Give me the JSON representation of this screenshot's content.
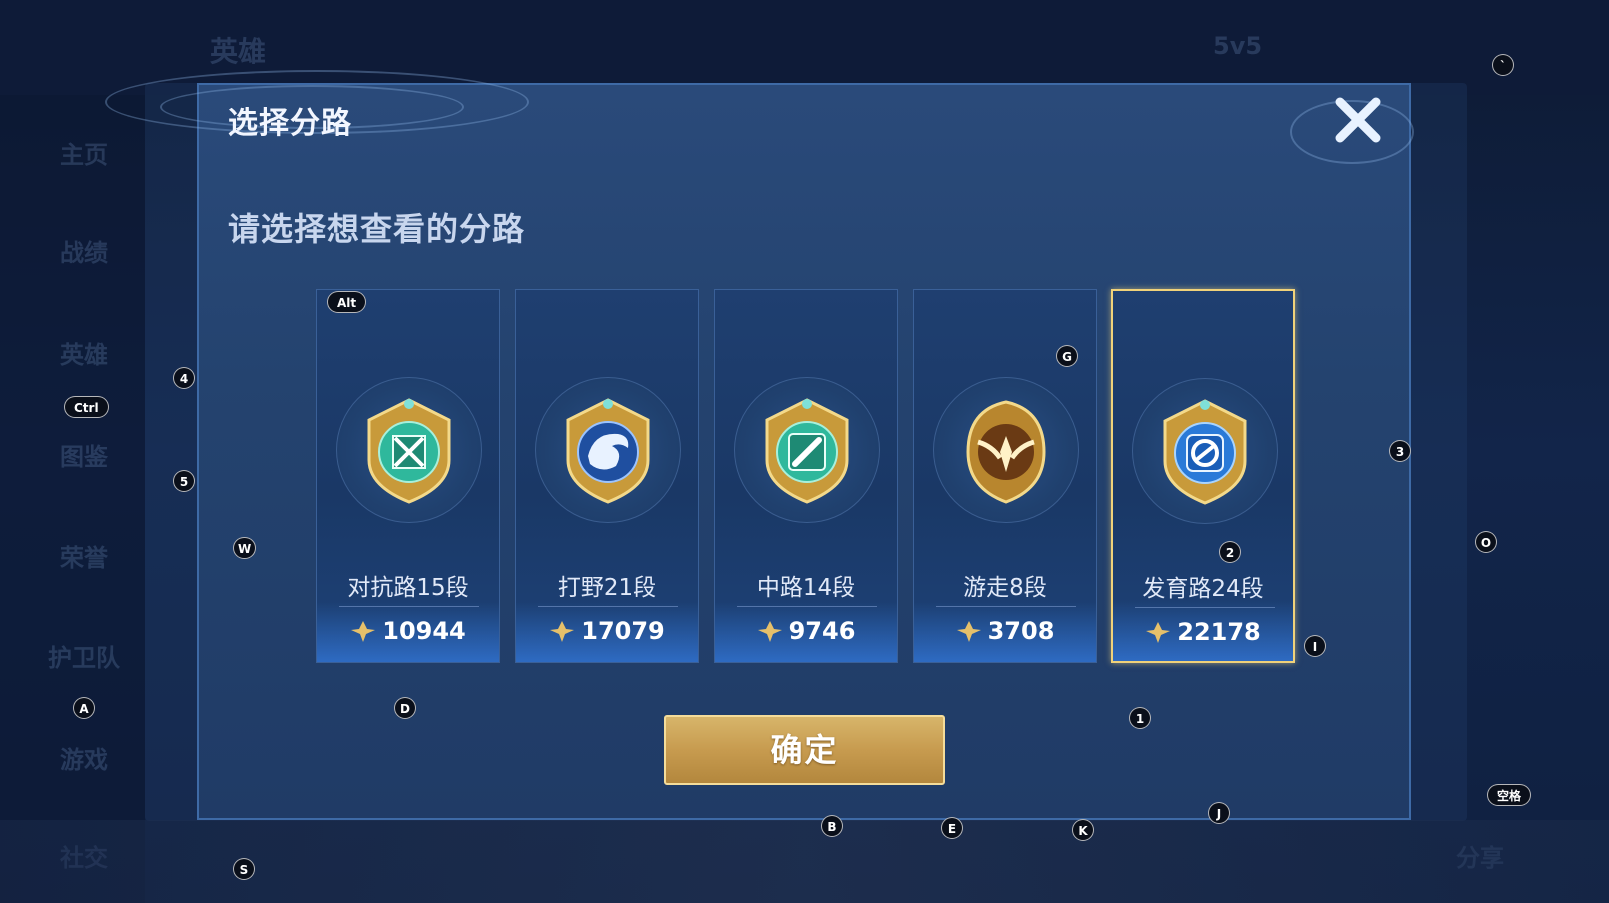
{
  "dialog": {
    "title": "选择分路",
    "subtitle": "请选择想查看的分路",
    "confirm_label": "确定",
    "lanes": [
      {
        "label": "对抗路15段",
        "score": "10944",
        "emblem": "clash-lane-icon",
        "selected": false
      },
      {
        "label": "打野21段",
        "score": "17079",
        "emblem": "jungle-icon",
        "selected": false
      },
      {
        "label": "中路14段",
        "score": "9746",
        "emblem": "mid-lane-icon",
        "selected": false
      },
      {
        "label": "游走8段",
        "score": "3708",
        "emblem": "roam-icon",
        "selected": false
      },
      {
        "label": "发育路24段",
        "score": "22178",
        "emblem": "farm-lane-icon",
        "selected": true
      }
    ]
  },
  "background": {
    "topbar_items": [
      "英雄",
      "5v5"
    ],
    "sidebar_items": [
      "主页",
      "战绩",
      "英雄",
      "图鉴",
      "荣誉",
      "护卫队",
      "游戏",
      "社交"
    ],
    "right_text": "分享"
  },
  "key_hints": {
    "alt": "Alt",
    "ctrl": "Ctrl",
    "k4": "4",
    "k5": "5",
    "w": "W",
    "a": "A",
    "d": "D",
    "s": "S",
    "g": "G",
    "k2": "2",
    "i": "I",
    "k1": "1",
    "k3": "3",
    "o": "O",
    "space": "空格",
    "b": "B",
    "e": "E",
    "k": "K",
    "j": "J",
    "backtick": "`"
  },
  "colors": {
    "accent_gold": "#f0d27a",
    "dialog_bg": "#24436f",
    "confirm_gold": "#c79b4f"
  }
}
